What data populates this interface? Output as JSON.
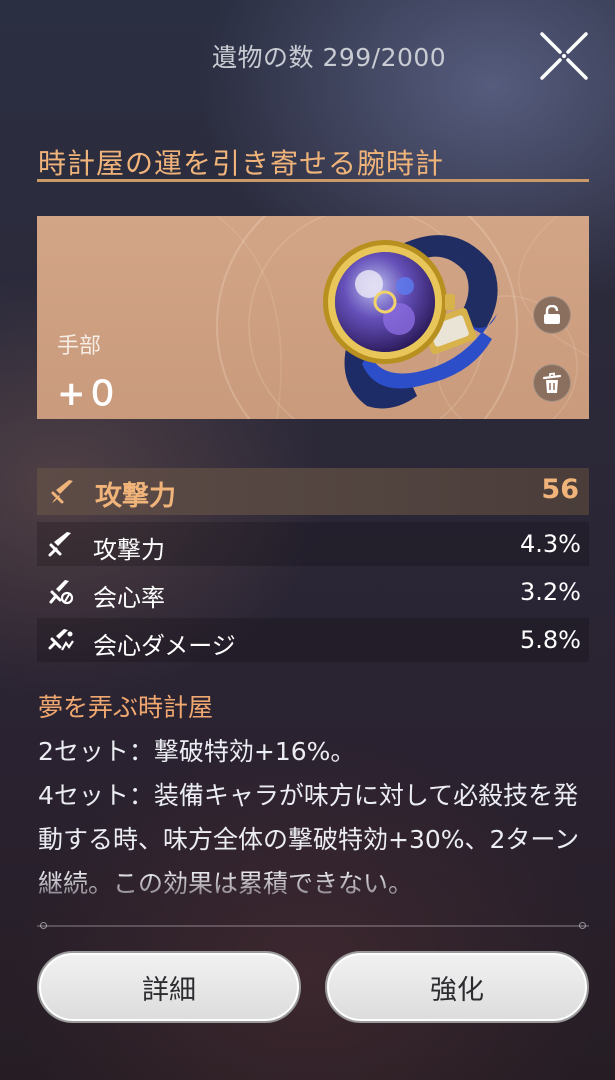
{
  "header": {
    "relic_count": "遺物の数 299/2000",
    "close_icon": "close-x-icon"
  },
  "relic": {
    "name": "時計屋の運を引き寄せる腕時計",
    "slot": "手部",
    "level": "+０",
    "image": "wristwatch-icon",
    "lock_icon": "lock-icon",
    "discard_icon": "trash-icon"
  },
  "main_stat": {
    "icon": "sword-icon",
    "name": "攻撃力",
    "value": "56"
  },
  "sub_stats": [
    {
      "icon": "sword-icon",
      "name": "攻撃力",
      "value": "4.3%"
    },
    {
      "icon": "crit-rate-icon",
      "name": "会心率",
      "value": "3.2%"
    },
    {
      "icon": "crit-damage-icon",
      "name": "会心ダメージ",
      "value": "5.8%"
    }
  ],
  "set": {
    "name": "夢を弄ぶ時計屋",
    "two_piece": "2セット：撃破特効+16%。",
    "four_piece": "4セット：装備キャラが味方に対して必殺技を発動する時、味方全体の撃破特効+30%、2ターン継続。この効果は累積できない。"
  },
  "buttons": {
    "detail": "詳細",
    "enhance": "強化"
  },
  "colors": {
    "accent": "#f0b47a",
    "card": "#cd9f80",
    "button": "#e8e8e8"
  }
}
